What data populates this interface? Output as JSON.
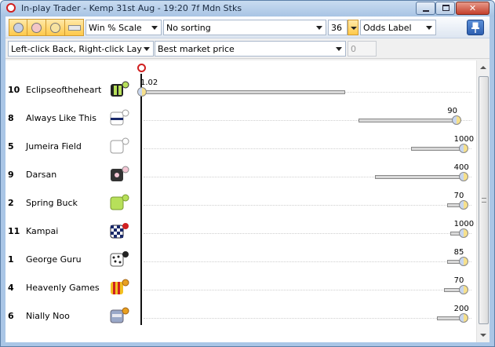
{
  "window": {
    "title": "In-play Trader - Kemp 31st Aug - 19:20 7f Mdn Stks",
    "min_glyph": "",
    "max_glyph": "",
    "close_glyph": "✕"
  },
  "toolbar": {
    "scale_select": "Win % Scale",
    "sorting_select": "No sorting",
    "count_value": "36",
    "label_select": "Odds Label",
    "click_mode_select": "Left-click Back, Right-click Lay",
    "price_select": "Best market price",
    "stake_value": "0"
  },
  "runners": [
    {
      "number": "10",
      "name": "Eclipseoftheheart",
      "odds": "1.02",
      "silk": "silk-black-lime",
      "bar": [
        0.0,
        0.62
      ],
      "knob": 0.0
    },
    {
      "number": "8",
      "name": "Always Like This",
      "odds": "90",
      "silk": "silk-white-navy-band",
      "bar": [
        0.66,
        0.96
      ],
      "knob": 0.96
    },
    {
      "number": "5",
      "name": "Jumeira Field",
      "odds": "1000",
      "silk": "silk-white",
      "bar": [
        0.82,
        0.98
      ],
      "knob": 0.98
    },
    {
      "number": "9",
      "name": "Darsan",
      "odds": "400",
      "silk": "silk-black-pink-star",
      "bar": [
        0.71,
        0.98
      ],
      "knob": 0.98
    },
    {
      "number": "2",
      "name": "Spring Buck",
      "odds": "70",
      "silk": "silk-lime",
      "bar": [
        0.93,
        0.98
      ],
      "knob": 0.98
    },
    {
      "number": "11",
      "name": "Kampai",
      "odds": "1000",
      "silk": "silk-blue-white-check",
      "bar": [
        0.94,
        0.98
      ],
      "knob": 0.98
    },
    {
      "number": "1",
      "name": "George Guru",
      "odds": "85",
      "silk": "silk-white-black-spots",
      "bar": [
        0.93,
        0.98
      ],
      "knob": 0.98
    },
    {
      "number": "4",
      "name": "Heavenly Games",
      "odds": "70",
      "silk": "silk-red-yellow-stripes",
      "bar": [
        0.92,
        0.98
      ],
      "knob": 0.98
    },
    {
      "number": "6",
      "name": "Nially Noo",
      "odds": "200",
      "silk": "silk-grey-blue",
      "bar": [
        0.9,
        0.98
      ],
      "knob": 0.98
    }
  ]
}
